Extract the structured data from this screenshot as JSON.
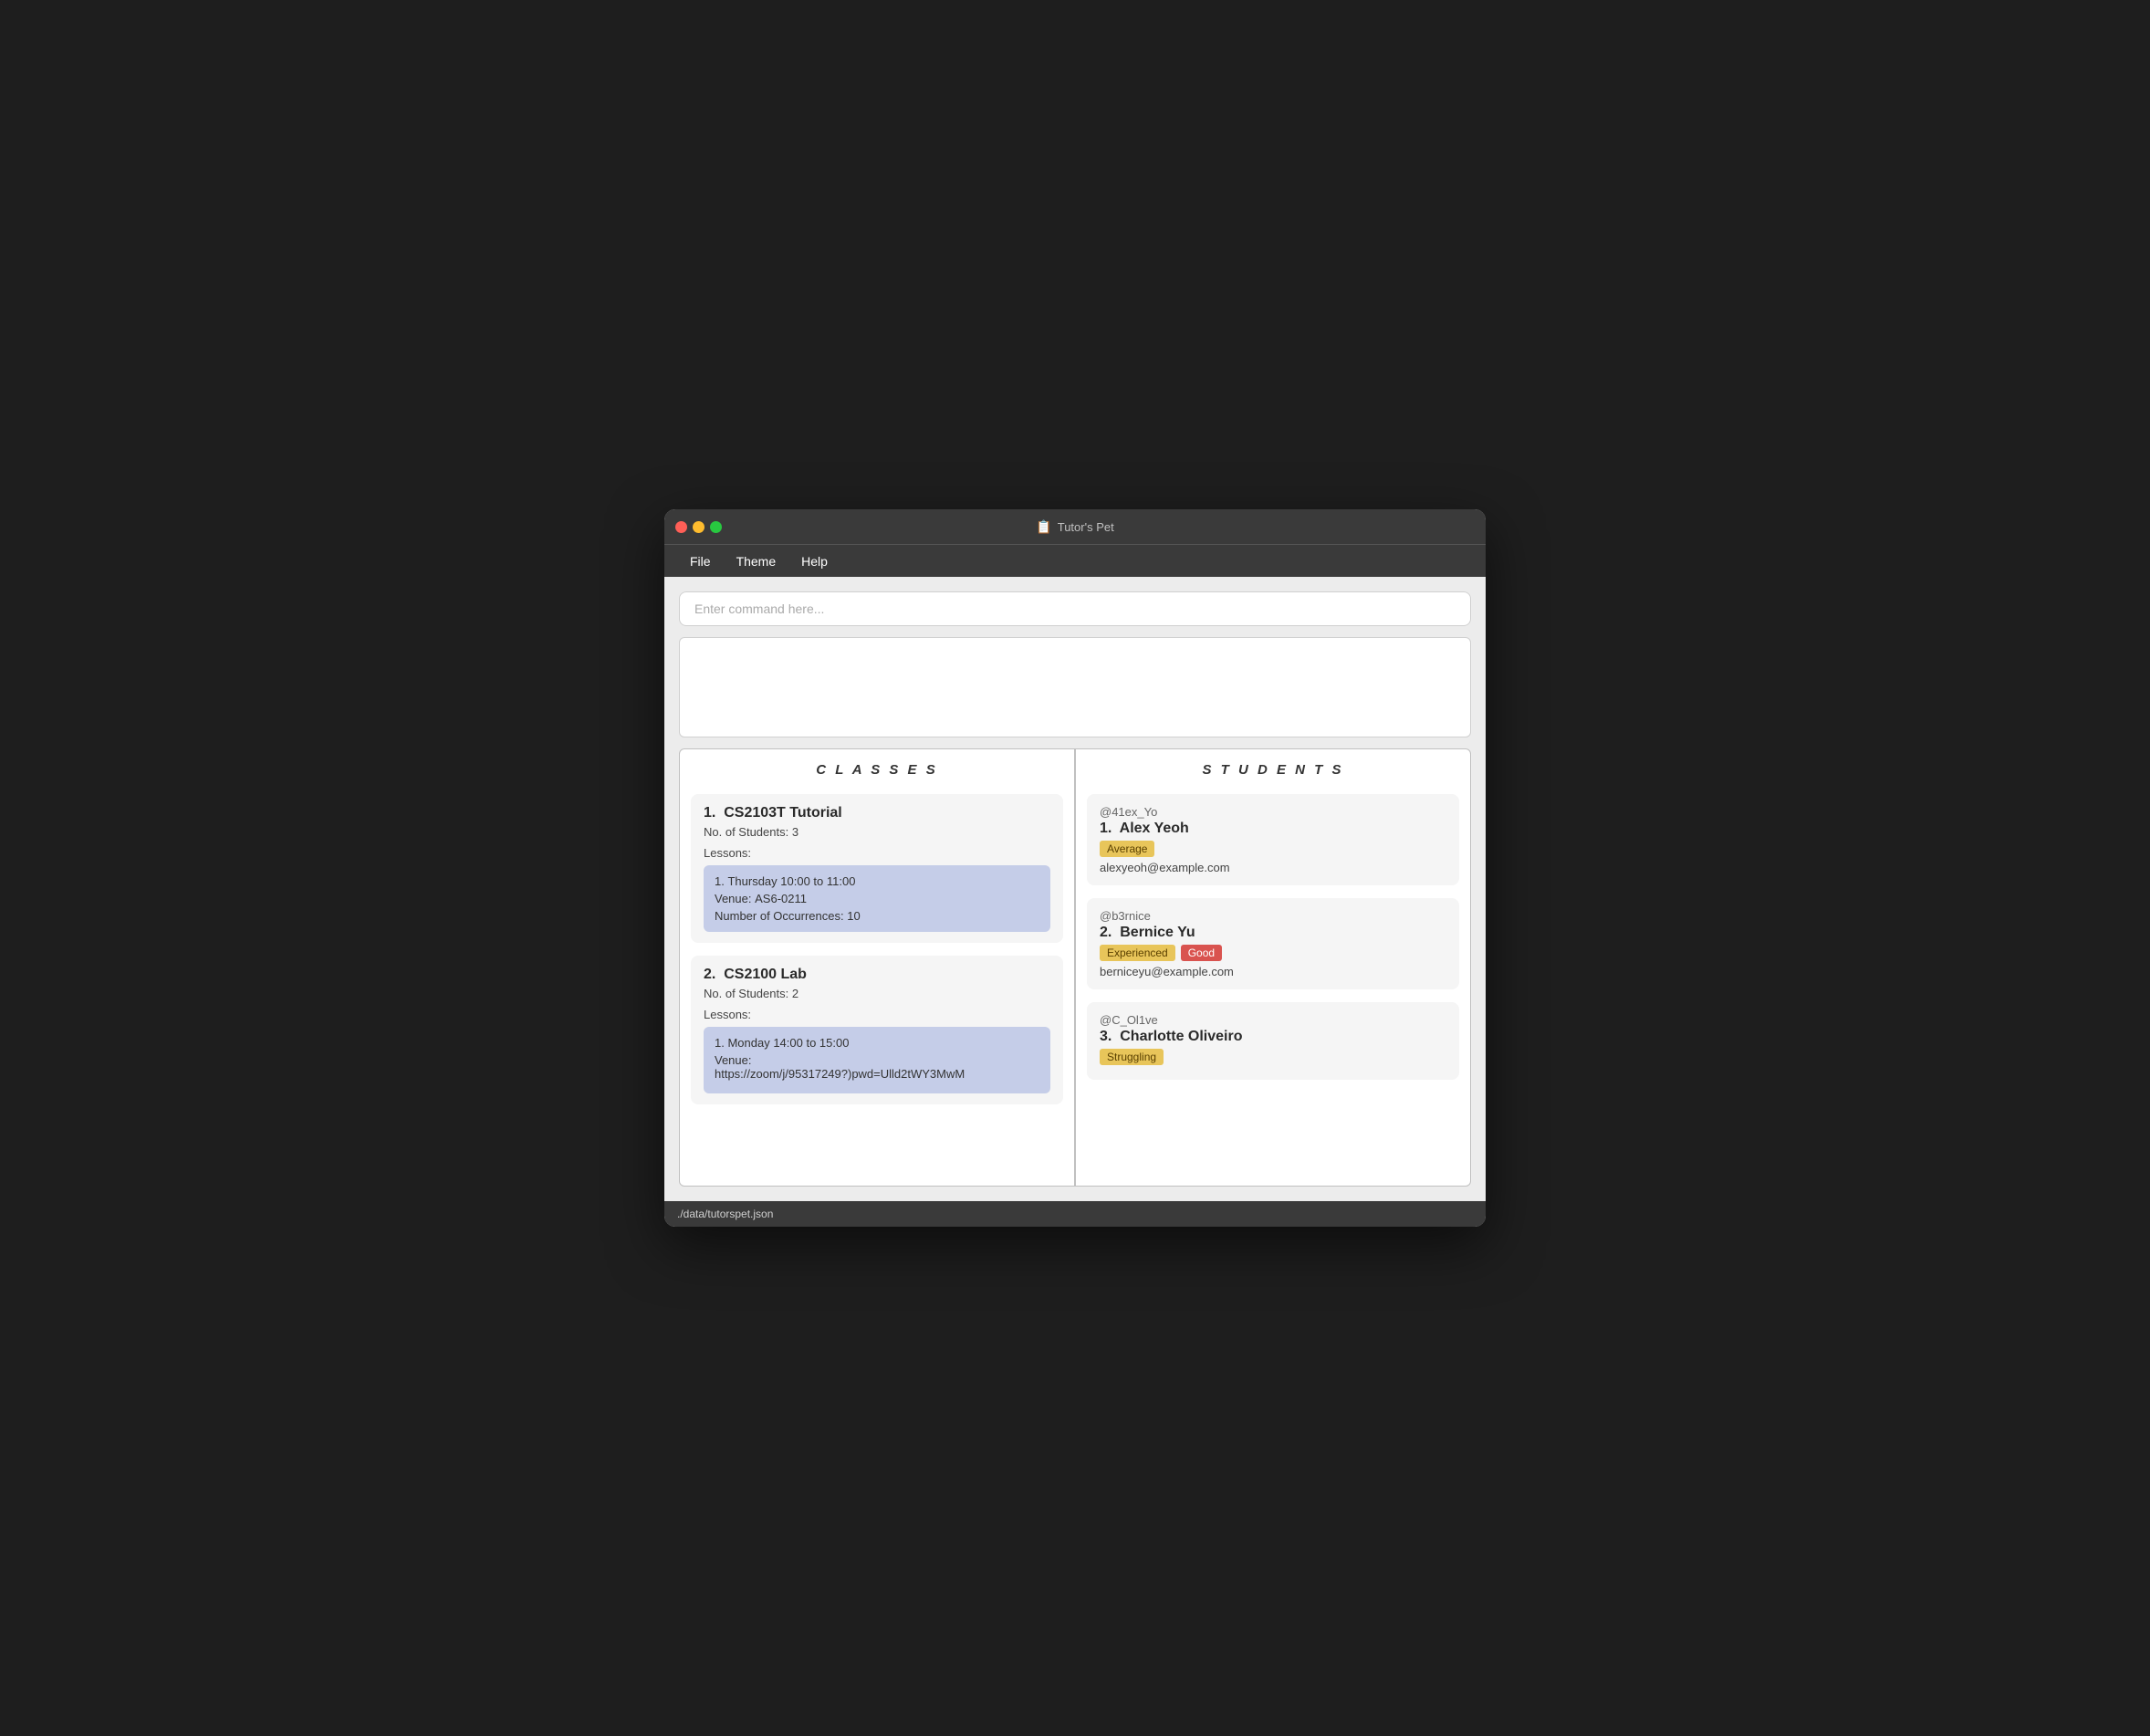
{
  "window": {
    "title": "Tutor's Pet",
    "title_icon": "📋"
  },
  "menu": {
    "items": [
      "File",
      "Theme",
      "Help"
    ]
  },
  "command": {
    "placeholder": "Enter command here..."
  },
  "classes_panel": {
    "header": "C L A S S E S",
    "classes": [
      {
        "index": "1.",
        "name": "CS2103T Tutorial",
        "students_label": "No. of Students:",
        "students_count": "3",
        "lessons_label": "Lessons:",
        "lessons": [
          {
            "index": "1.",
            "time": "Thursday 10:00 to 11:00",
            "venue_label": "Venue:",
            "venue": "AS6-0211",
            "occurrences_label": "Number of Occurrences:",
            "occurrences": "10"
          }
        ]
      },
      {
        "index": "2.",
        "name": "CS2100 Lab",
        "students_label": "No. of Students:",
        "students_count": "2",
        "lessons_label": "Lessons:",
        "lessons": [
          {
            "index": "1.",
            "time": "Monday 14:00 to 15:00",
            "venue_label": "Venue:",
            "venue": "https://zoom/j/95317249?)pwd=Ulld2tWY3MwM",
            "occurrences_label": "",
            "occurrences": ""
          }
        ]
      }
    ]
  },
  "students_panel": {
    "header": "S T U D E N T S",
    "students": [
      {
        "handle": "@41ex_Yo",
        "index": "1.",
        "name": "Alex Yeoh",
        "tags": [
          {
            "label": "Average",
            "type": "average"
          }
        ],
        "email": "alexyeoh@example.com"
      },
      {
        "handle": "@b3rnice",
        "index": "2.",
        "name": "Bernice Yu",
        "tags": [
          {
            "label": "Experienced",
            "type": "experienced"
          },
          {
            "label": "Good",
            "type": "good"
          }
        ],
        "email": "berniceyu@example.com"
      },
      {
        "handle": "@C_Ol1ve",
        "index": "3.",
        "name": "Charlotte Oliveiro",
        "tags": [
          {
            "label": "Struggling",
            "type": "struggling"
          }
        ],
        "email": ""
      }
    ]
  },
  "status_bar": {
    "text": "./data/tutorspet.json"
  }
}
